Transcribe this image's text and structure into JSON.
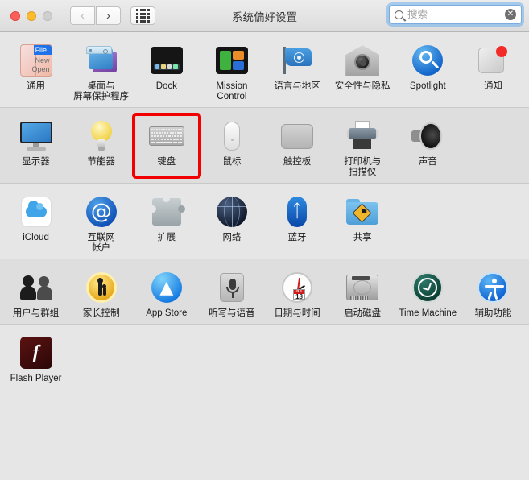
{
  "window": {
    "title": "系统偏好设置",
    "traffic_lights": [
      "close",
      "minimize",
      "zoom"
    ],
    "accent_color": "#1f72e8",
    "highlight_color": "#f20000",
    "badge_color": "#f32b28"
  },
  "toolbar": {
    "back_label": "‹",
    "forward_label": "›",
    "grid_label": "show-all",
    "search": {
      "placeholder": "搜索",
      "value": "",
      "clear_label": "✕"
    }
  },
  "rows": [
    {
      "shade": "light",
      "items": [
        {
          "name": "general",
          "label": "通用",
          "icon": "general-icon",
          "art": {
            "menu": "File",
            "line1": "New",
            "line2": "Open"
          }
        },
        {
          "name": "desktop-screensaver",
          "label": "桌面与\n屏幕保护程序",
          "icon": "desktop-screensaver-icon"
        },
        {
          "name": "dock",
          "label": "Dock",
          "icon": "dock-icon"
        },
        {
          "name": "mission-control",
          "label": "Mission\nControl",
          "icon": "mission-control-icon"
        },
        {
          "name": "language-region",
          "label": "语言与地区",
          "icon": "language-region-icon"
        },
        {
          "name": "security-privacy",
          "label": "安全性与隐私",
          "icon": "security-privacy-icon"
        },
        {
          "name": "spotlight",
          "label": "Spotlight",
          "icon": "spotlight-icon"
        },
        {
          "name": "notifications",
          "label": "通知",
          "icon": "notifications-icon",
          "badge": true
        }
      ]
    },
    {
      "shade": "dark",
      "highlighted_index": 2,
      "items": [
        {
          "name": "displays",
          "label": "显示器",
          "icon": "displays-icon"
        },
        {
          "name": "energy-saver",
          "label": "节能器",
          "icon": "energy-saver-icon"
        },
        {
          "name": "keyboard",
          "label": "键盘",
          "icon": "keyboard-icon"
        },
        {
          "name": "mouse",
          "label": "鼠标",
          "icon": "mouse-icon"
        },
        {
          "name": "trackpad",
          "label": "触控板",
          "icon": "trackpad-icon"
        },
        {
          "name": "printers-scanners",
          "label": "打印机与\n扫描仪",
          "icon": "printer-icon"
        },
        {
          "name": "sound",
          "label": "声音",
          "icon": "speaker-icon"
        }
      ]
    },
    {
      "shade": "light",
      "items": [
        {
          "name": "icloud",
          "label": "iCloud",
          "icon": "icloud-icon"
        },
        {
          "name": "internet-accounts",
          "label": "互联网\n帐户",
          "icon": "at-sign-icon"
        },
        {
          "name": "extensions",
          "label": "扩展",
          "icon": "puzzle-piece-icon"
        },
        {
          "name": "network",
          "label": "网络",
          "icon": "globe-icon"
        },
        {
          "name": "bluetooth",
          "label": "蓝牙",
          "icon": "bluetooth-icon"
        },
        {
          "name": "sharing",
          "label": "共享",
          "icon": "sharing-folder-icon"
        }
      ]
    },
    {
      "shade": "dark",
      "items": [
        {
          "name": "users-groups",
          "label": "用户与群组",
          "icon": "users-icon"
        },
        {
          "name": "parental-controls",
          "label": "家长控制",
          "icon": "parental-controls-icon"
        },
        {
          "name": "app-store",
          "label": "App Store",
          "icon": "app-store-icon"
        },
        {
          "name": "dictation-speech",
          "label": "听写与语音",
          "icon": "microphone-icon"
        },
        {
          "name": "date-time",
          "label": "日期与时间",
          "icon": "clock-icon",
          "art": {
            "month": "JUL",
            "day": "18"
          }
        },
        {
          "name": "startup-disk",
          "label": "启动磁盘",
          "icon": "hard-disk-icon"
        },
        {
          "name": "time-machine",
          "label": "Time Machine",
          "icon": "time-machine-icon"
        },
        {
          "name": "accessibility",
          "label": "辅助功能",
          "icon": "accessibility-icon"
        }
      ]
    },
    {
      "shade": "light",
      "last": true,
      "items": [
        {
          "name": "flash-player",
          "label": "Flash Player",
          "icon": "flash-player-icon",
          "art": {
            "glyph": "f"
          }
        }
      ]
    }
  ]
}
